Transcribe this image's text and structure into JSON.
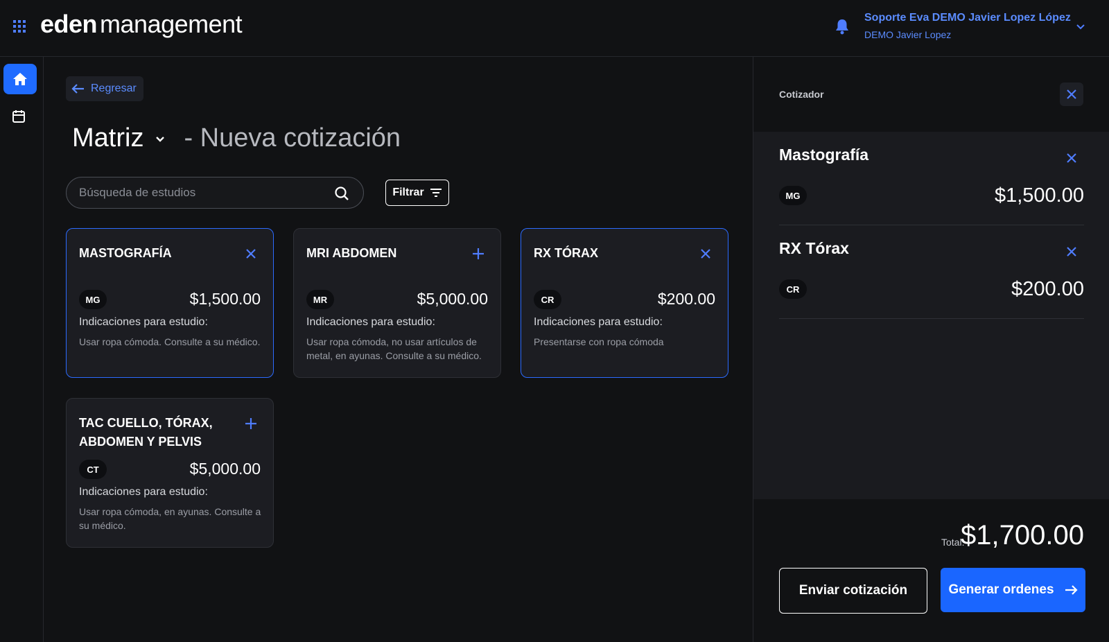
{
  "header": {
    "brand_bold": "eden",
    "brand_light": "management",
    "user_name": "Soporte Eva DEMO Javier Lopez López",
    "user_sub": "DEMO Javier Lopez",
    "icons": [
      "apps-grid-icon",
      "bell-icon",
      "chevron-down-icon"
    ]
  },
  "sidebar": {
    "items": [
      {
        "icon": "home-icon",
        "active": true
      },
      {
        "icon": "calendar-icon",
        "active": false
      }
    ]
  },
  "main": {
    "back_label": "Regresar",
    "title": "Matriz",
    "subtitle": "- Nueva cotización",
    "search_placeholder": "Búsqueda de estudios",
    "filter_label": "Filtrar",
    "studies": [
      {
        "title": "MASTOGRAFÍA",
        "badge": "MG",
        "price": "$1,500.00",
        "ind_label": "Indicaciones para estudio:",
        "ind_text": "Usar ropa cómoda. Consulte a su médico.",
        "selected": true
      },
      {
        "title": "MRI ABDOMEN",
        "badge": "MR",
        "price": "$5,000.00",
        "ind_label": "Indicaciones para estudio:",
        "ind_text": "Usar ropa cómoda, no usar artículos de metal, en ayunas. Consulte a su médico.",
        "selected": false
      },
      {
        "title": "RX TÓRAX",
        "badge": "CR",
        "price": "$200.00",
        "ind_label": "Indicaciones para estudio:",
        "ind_text": "Presentarse con ropa cómoda",
        "selected": true
      },
      {
        "title": "TAC CUELLO, TÓRAX, ABDOMEN Y PELVIS",
        "badge": "CT",
        "price": "$5,000.00",
        "ind_label": "Indicaciones para estudio:",
        "ind_text": "Usar ropa cómoda, en ayunas. Consulte a su médico.",
        "selected": false
      }
    ]
  },
  "panel": {
    "title": "Cotizador",
    "items": [
      {
        "name": "Mastografía",
        "badge": "MG",
        "price": "$1,500.00"
      },
      {
        "name": "RX Tórax",
        "badge": "CR",
        "price": "$200.00"
      }
    ],
    "total_label": "Total:",
    "total_value": "$1,700.00",
    "send_label": "Enviar cotización",
    "generate_label": "Generar ordenes"
  },
  "colors": {
    "accent": "#1a66ff",
    "accent_text": "#5b8cff",
    "background": "#111214",
    "card": "#1c1d22"
  }
}
